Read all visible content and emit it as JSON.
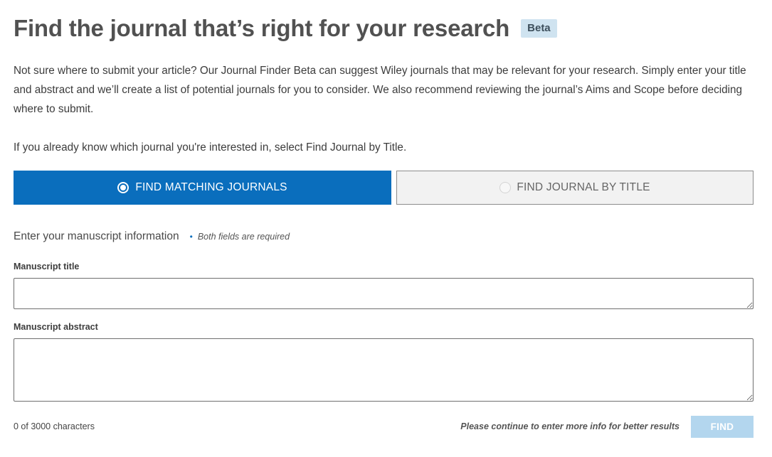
{
  "header": {
    "title": "Find the journal that’s right for your research",
    "badge": "Beta"
  },
  "intro": {
    "paragraph1": "Not sure where to submit your article? Our Journal Finder Beta can suggest Wiley journals that may be relevant for your research. Simply enter your title and abstract and we’ll create a list of potential journals for you to consider. We also recommend reviewing the journal’s Aims and Scope before deciding where to submit.",
    "paragraph2": "If you already know which journal you're interested in, select Find Journal by Title."
  },
  "modes": {
    "matching_label": "FIND MATCHING JOURNALS",
    "matching_selected": true,
    "by_title_label": "FIND JOURNAL BY TITLE",
    "by_title_selected": false
  },
  "form": {
    "section_label": "Enter your manuscript information",
    "required_note": "Both fields are required",
    "title_label": "Manuscript title",
    "title_value": "",
    "abstract_label": "Manuscript abstract",
    "abstract_value": "",
    "char_count": "0 of 3000 characters",
    "hint": "Please continue to enter more info for better results",
    "find_label": "FIND"
  },
  "colors": {
    "primary": "#0a6ebd",
    "badge_bg": "#cfe3f0",
    "disabled_button": "#b3d6ee"
  }
}
